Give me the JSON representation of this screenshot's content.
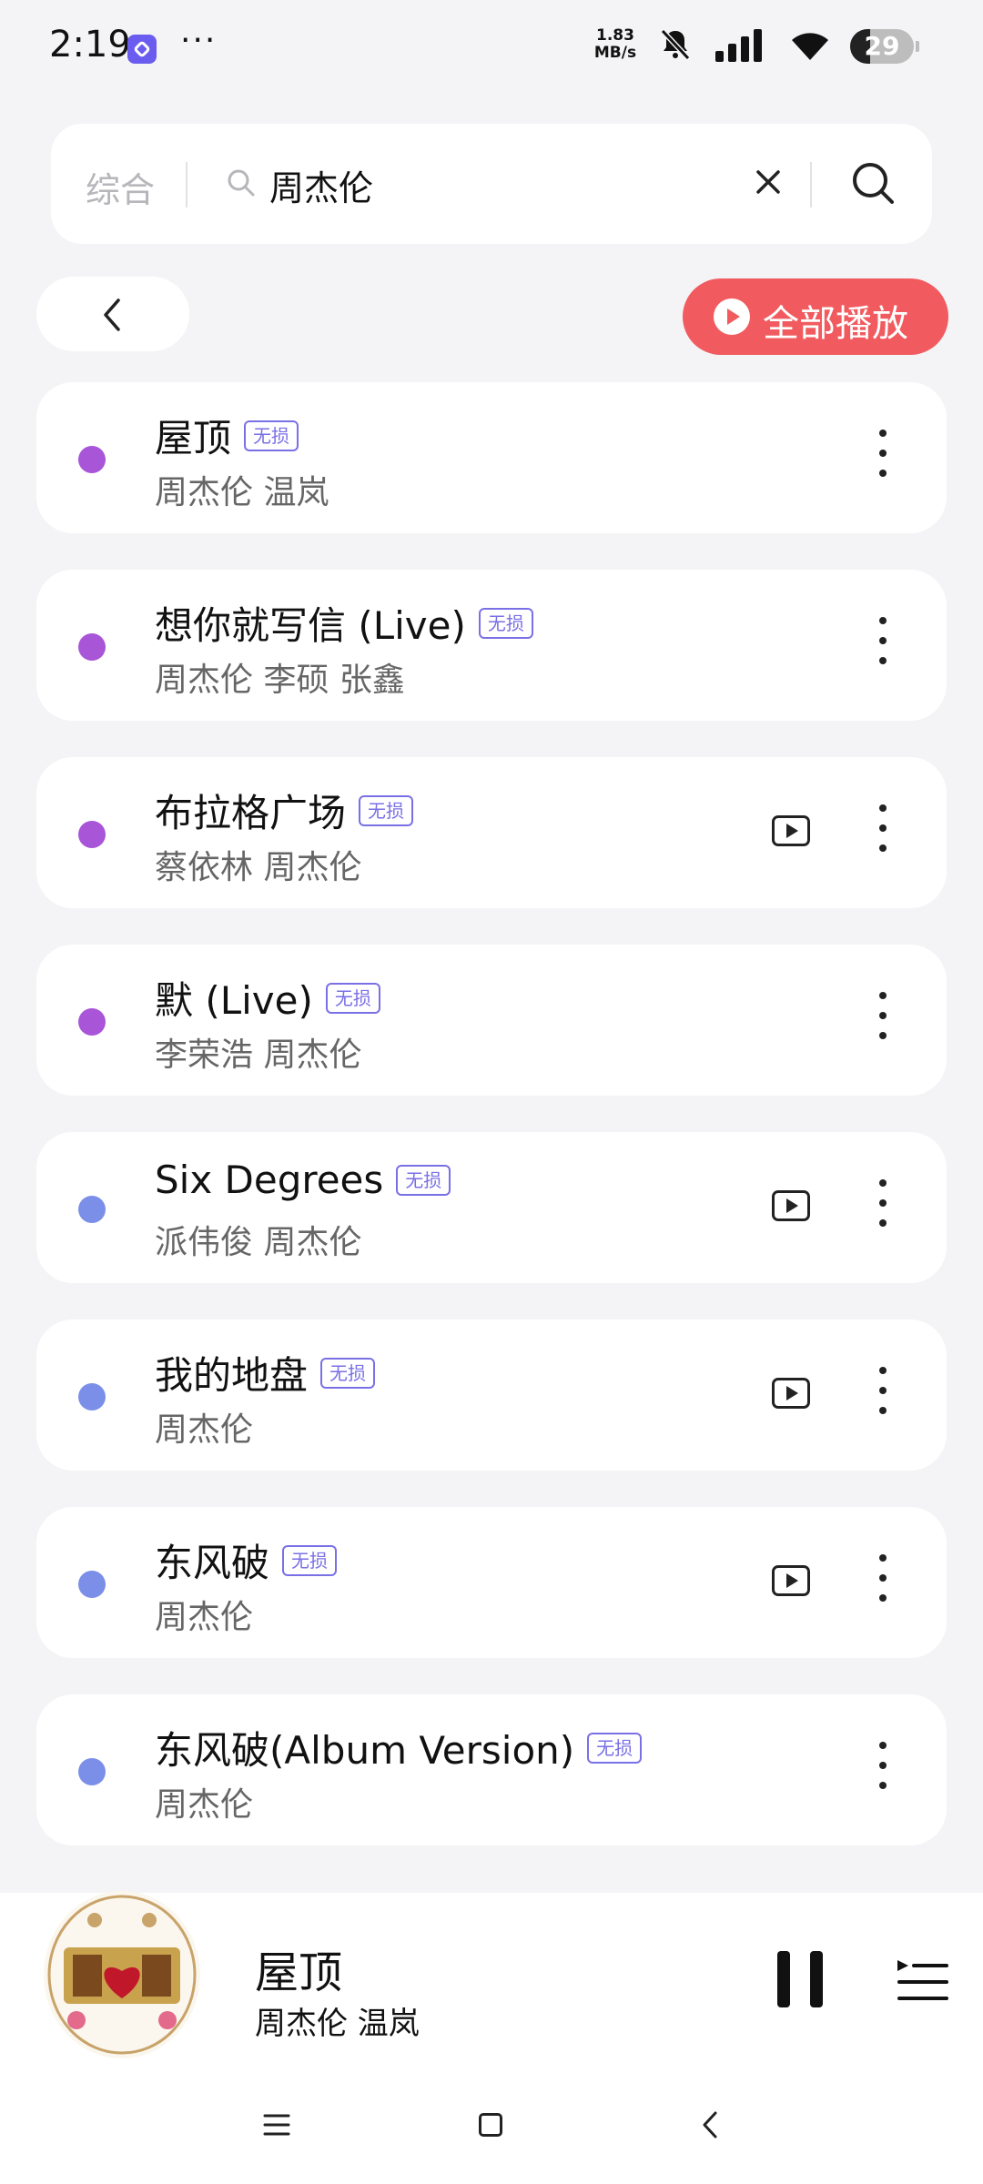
{
  "status_bar": {
    "time": "2:19",
    "more": "···",
    "net_speed_value": "1.83",
    "net_speed_unit": "MB/s",
    "battery": "29"
  },
  "search": {
    "category": "综合",
    "query": "周杰伦"
  },
  "actions": {
    "play_all": "全部播放"
  },
  "badge_label": "无损",
  "songs": [
    {
      "title": "屋顶",
      "artists": "周杰伦 温岚",
      "dot_color": "#a855d8",
      "has_mv": false
    },
    {
      "title": "想你就写信 (Live)",
      "artists": "周杰伦 李硕 张鑫",
      "dot_color": "#a855d8",
      "has_mv": false
    },
    {
      "title": "布拉格广场",
      "artists": "蔡依林 周杰伦",
      "dot_color": "#a855d8",
      "has_mv": true
    },
    {
      "title": "默 (Live)",
      "artists": "李荣浩 周杰伦",
      "dot_color": "#a855d8",
      "has_mv": false
    },
    {
      "title": "Six Degrees",
      "artists": "派伟俊 周杰伦",
      "dot_color": "#7b8fe8",
      "has_mv": true
    },
    {
      "title": "我的地盘",
      "artists": "周杰伦",
      "dot_color": "#7b8fe8",
      "has_mv": true
    },
    {
      "title": "东风破",
      "artists": "周杰伦",
      "dot_color": "#7b8fe8",
      "has_mv": true
    },
    {
      "title": "东风破(Album Version)",
      "artists": "周杰伦",
      "dot_color": "#7b8fe8",
      "has_mv": false
    }
  ],
  "now_playing": {
    "title": "屋顶",
    "artists": "周杰伦 温岚"
  }
}
